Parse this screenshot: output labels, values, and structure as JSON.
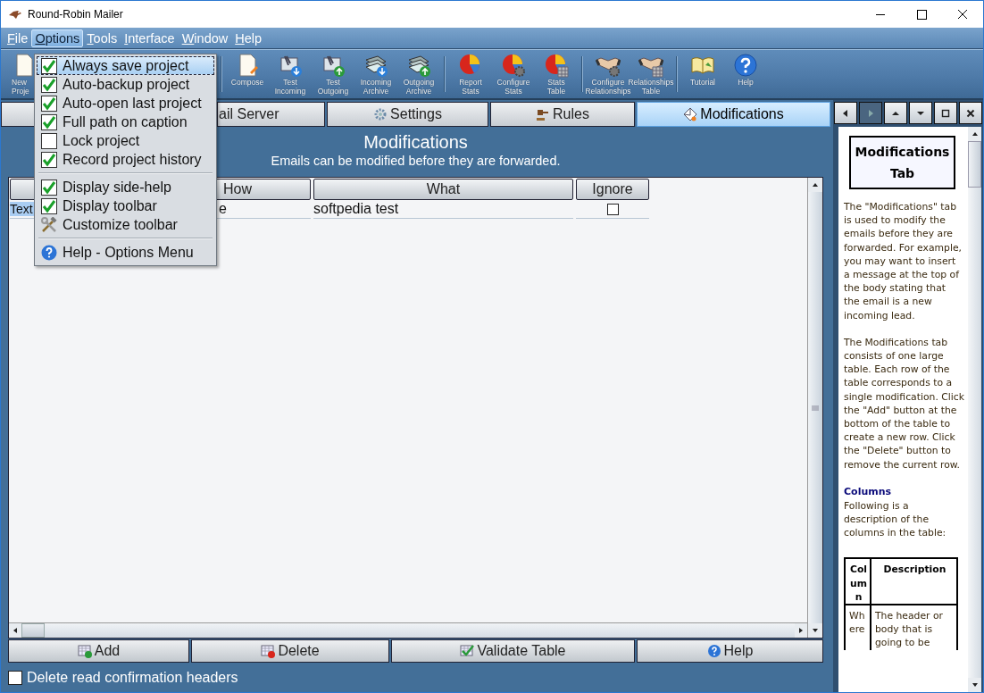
{
  "window": {
    "title": "Round-Robin Mailer"
  },
  "menu_bar": [
    {
      "label": "File",
      "selected": false
    },
    {
      "label": "Options",
      "selected": true
    },
    {
      "label": "Tools",
      "selected": false
    },
    {
      "label": "Interface",
      "selected": false
    },
    {
      "label": "Window",
      "selected": false
    },
    {
      "label": "Help",
      "selected": false
    }
  ],
  "options_menu": [
    {
      "kind": "check",
      "label": "Always save project",
      "checked": true,
      "selected": true
    },
    {
      "kind": "check",
      "label": "Auto-backup project",
      "checked": true,
      "selected": false
    },
    {
      "kind": "check",
      "label": "Auto-open last project",
      "checked": true,
      "selected": false
    },
    {
      "kind": "check",
      "label": "Full path on caption",
      "checked": true,
      "selected": false
    },
    {
      "kind": "check",
      "label": "Lock project",
      "checked": false,
      "selected": false
    },
    {
      "kind": "check",
      "label": "Record project history",
      "checked": true,
      "selected": false
    },
    {
      "kind": "separator"
    },
    {
      "kind": "check",
      "label": "Display side-help",
      "checked": true,
      "selected": false
    },
    {
      "kind": "check",
      "label": "Display toolbar",
      "checked": true,
      "selected": false
    },
    {
      "kind": "tools",
      "label": "Customize toolbar",
      "selected": false
    },
    {
      "kind": "separator"
    },
    {
      "kind": "help",
      "label": "Help - Options Menu",
      "selected": false
    }
  ],
  "toolbar": [
    [
      {
        "label": "New Proje"
      }
    ],
    [
      {
        "label": "Compose"
      },
      {
        "label": "Test Incoming"
      },
      {
        "label": "Test Outgoing"
      },
      {
        "label": "Incoming Archive"
      },
      {
        "label": "Outgoing Archive"
      }
    ],
    [
      {
        "label": "Report Stats"
      },
      {
        "label": "Configure Stats"
      },
      {
        "label": "Stats Table"
      }
    ],
    [
      {
        "label": "Configure Relationships"
      },
      {
        "label": "Relationships Table"
      }
    ],
    [
      {
        "label": "Tutorial"
      },
      {
        "label": "Help"
      }
    ]
  ],
  "tabs": [
    {
      "label": "ail Server",
      "selected": false
    },
    {
      "label": "Settings",
      "selected": false
    },
    {
      "label": "Rules",
      "selected": false
    },
    {
      "label": "Modifications",
      "selected": true
    }
  ],
  "header": {
    "title": "Modifications",
    "subtitle": "Emails can be modified before they are forwarded."
  },
  "table": {
    "columns": [
      "How",
      "What",
      "Ignore"
    ],
    "rows": [
      {
        "cells": [
          "Text",
          "e",
          "softpedia test"
        ],
        "ignore": false,
        "selected": true
      }
    ]
  },
  "buttons": [
    {
      "kind": "add",
      "label": "Add"
    },
    {
      "kind": "delete",
      "label": "Delete"
    },
    {
      "kind": "validate",
      "label": "Validate Table"
    },
    {
      "kind": "help",
      "label": "Help"
    }
  ],
  "option": {
    "label": "Delete read confirmation headers",
    "checked": false
  },
  "help_panel": {
    "title": "Modifications Tab",
    "paragraphs": [
      "The \"Modifications\" tab is used to modify the emails before they are forwarded.  For example, you may want to insert a message at the top of the body stating that the email is a new incoming lead.",
      "The Modifications tab consists of one large table.  Each row of the table corresponds to a single modification. Click the \"Add\" button at the bottom of the table to create a new row.  Click the \"Delete\" button to remove the current row."
    ],
    "heading": "Columns",
    "intro": "Following is a description of the columns in the table:",
    "table": {
      "columns": [
        "Column",
        "Description"
      ],
      "rows": [
        [
          "Where",
          "The header or body that is going to be"
        ]
      ]
    }
  }
}
